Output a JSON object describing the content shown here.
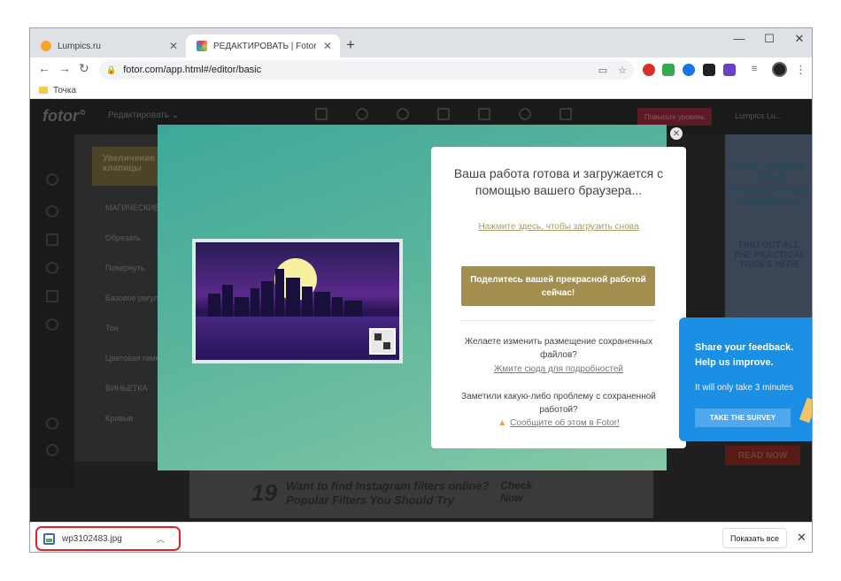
{
  "browser": {
    "tabs": [
      {
        "label": "Lumpics.ru",
        "favicon_color": "#f5a623",
        "active": false
      },
      {
        "label": "РЕДАКТИРОВАТЬ | Fotor",
        "favicon_color": "#e23b5b",
        "active": true
      }
    ],
    "address": "fotor.com/app.html#/editor/basic",
    "bookmark": "Точка"
  },
  "fotor": {
    "logo": "fotor°",
    "edit_menu": "Редактировать",
    "premium": "Повысьте уровень",
    "user": "Lumpics Lu...",
    "magnify": "Увеличение клапицы",
    "menu": [
      "МАГИЧЕСКИЕ",
      "Обрезать",
      "Повернуть",
      "Базовое регул",
      "Тон",
      "Цветовая гамм",
      "ВИНЬЕТКА",
      "Кривые"
    ],
    "ad_right": "HOW TO SELL YOUR PRODUCTS ON PINTEREST?",
    "ad_right_sub": "FIND OUT ALL THE PRACTICAL TRICKS HERE",
    "ad_read": "READ NOW",
    "ad_bottom_num": "19",
    "ad_bottom": "Want to find Instagram filters online? Popular Filters You Should Try",
    "ad_bottom_cta": "Check Now"
  },
  "modal": {
    "title": "Ваша работа готова и загружается с помощью вашего браузера...",
    "reload_link": "Нажмите здесь, чтобы загрузить снова",
    "share_button": "Поделитесь вашей прекрасной работой сейчас!",
    "location_q": "Желаете изменить размещение сохраненных файлов?",
    "location_link": "Жмите сюда для подробностей",
    "problem_q": "Заметили какую-либо проблему с сохраненной работой?",
    "problem_link": "Сообщите об этом в Fotor!"
  },
  "survey": {
    "title": "Share your feedback. Help us improve.",
    "subtitle": "It will only take 3 minutes",
    "button": "TAKE THE SURVEY"
  },
  "downloads": {
    "file": "wp3102483.jpg",
    "show_all": "Показать все"
  }
}
